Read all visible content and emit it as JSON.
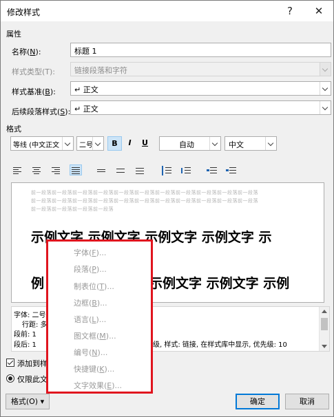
{
  "window": {
    "title": "修改样式",
    "help": "?",
    "close": "✕"
  },
  "properties": {
    "section_label": "属性",
    "name_label": "名称(",
    "name_key": "N",
    "name_value": "标题 1",
    "type_label": "样式类型(T):",
    "type_value": "链接段落和字符",
    "based_label": "样式基准(",
    "based_key": "B",
    "based_value": "↵ 正文",
    "next_label": "后续段落样式(",
    "next_key": "S",
    "next_value": "↵ 正文"
  },
  "format": {
    "section_label": "格式",
    "font": "等线 (中文正文",
    "size": "二号",
    "bold": "B",
    "italic": "I",
    "underline": "U",
    "color": "自动",
    "language": "中文"
  },
  "preview": {
    "prev_paragraph_1": "前一段落前一段落前一段落前一段落前一段落前一段落前一段落前一段落前一段落前一段落前一段落",
    "prev_paragraph_2": "前一段落前一段落前一段落前一段落前一段落前一段落前一段落前一段落前一段落前一段落前一段落",
    "prev_paragraph_3": "前一段落前一段落前一段落前一段落",
    "sample_line_1": "示例文字  示例文字  示例文字  示例文字  示",
    "sample_line_2_start": "例",
    "sample_line_2_end": "示例文字  示例文字  示例"
  },
  "description": {
    "line1": "字体: 二号",
    "line2": "行距: 多",
    "line3": "段前: 1",
    "line4_start": "段后: 1",
    "line4_end": "级, 样式: 链接, 在样式库中显示, 优先级: 10"
  },
  "options": {
    "add_to_gallery": "添加到样",
    "only_this_doc": "仅限此文"
  },
  "buttons": {
    "format": "格式(O) ▾",
    "ok": "确定",
    "cancel": "取消"
  },
  "menu": {
    "items": [
      {
        "label": "字体(",
        "key": "F",
        "suffix": ")..."
      },
      {
        "label": "段落(",
        "key": "P",
        "suffix": ")..."
      },
      {
        "label": "制表位(",
        "key": "T",
        "suffix": ")..."
      },
      {
        "label": "边框(",
        "key": "B",
        "suffix": ")..."
      },
      {
        "label": "语言(",
        "key": "L",
        "suffix": ")..."
      },
      {
        "label": "图文框(",
        "key": "M",
        "suffix": ")..."
      },
      {
        "label": "编号(",
        "key": "N",
        "suffix": ")..."
      },
      {
        "label": "快捷键(",
        "key": "K",
        "suffix": ")..."
      },
      {
        "label": "文字效果(",
        "key": "E",
        "suffix": ")..."
      }
    ]
  },
  "colors": {
    "menu_highlight_border": "#e0141e",
    "selected_button": "#cce4f7",
    "primary_button_border": "#0078d7"
  }
}
